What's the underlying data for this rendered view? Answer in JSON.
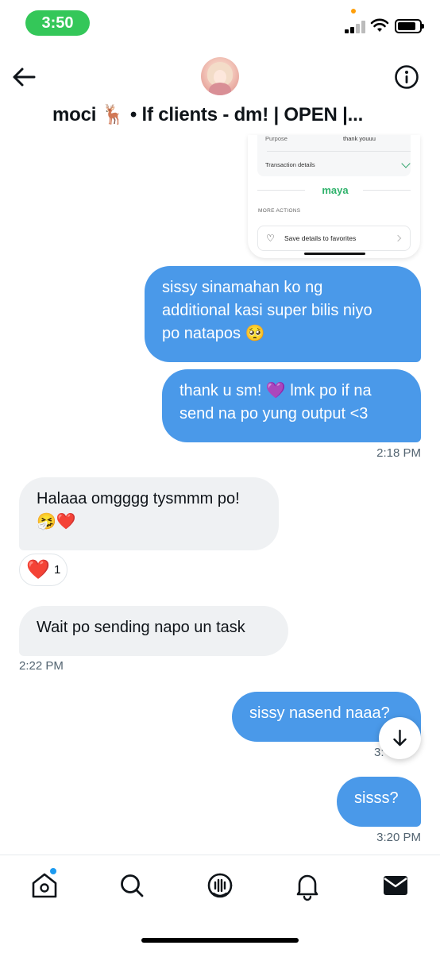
{
  "status_bar": {
    "time": "3:50"
  },
  "header": {
    "title": "moci 🦌 • lf clients - dm! | OPEN |..."
  },
  "screenshot": {
    "purpose_label": "Purpose",
    "purpose_value": "thank youuu",
    "transaction_details_label": "Transaction details",
    "brand": "maya",
    "more_actions_label": "MORE ACTIONS",
    "favorites_label": "Save details to favorites"
  },
  "messages": [
    {
      "id": "m1",
      "direction": "outgoing",
      "lines": [
        "sissy sinamahan ko ng",
        "additional kasi super bilis niyo",
        "po natapos 🥺"
      ]
    },
    {
      "id": "m2",
      "direction": "outgoing",
      "lines": [
        "thank u sm! 💜 lmk po if na",
        "send na po yung output <3"
      ],
      "timestamp": "2:18 PM"
    },
    {
      "id": "m3",
      "direction": "incoming",
      "lines": [
        "Halaaa omgggg tysmmm po!",
        "🤧❤️"
      ],
      "reaction": {
        "emoji": "❤️",
        "count": "1"
      }
    },
    {
      "id": "m4",
      "direction": "incoming",
      "lines": [
        "Wait po sending napo un task"
      ],
      "timestamp": "2:22 PM"
    },
    {
      "id": "m5",
      "direction": "outgoing",
      "lines": [
        "sissy nasend naaa?"
      ],
      "timestamp": "3:"
    },
    {
      "id": "m6",
      "direction": "outgoing",
      "lines": [
        "sisss?"
      ],
      "timestamp": "3:20 PM"
    }
  ],
  "nav": {
    "items": [
      {
        "name": "home",
        "icon": "home-icon",
        "has_notification_dot": true
      },
      {
        "name": "search",
        "icon": "search-icon"
      },
      {
        "name": "spaces",
        "icon": "spaces-icon"
      },
      {
        "name": "notifications",
        "icon": "bell-icon"
      },
      {
        "name": "messages",
        "icon": "envelope-icon",
        "active": true
      }
    ]
  },
  "colors": {
    "outgoing_bubble": "#4a99e9",
    "incoming_bubble": "#eff1f3",
    "timestamp": "#536471",
    "time_pill": "#34c759",
    "reaction_heart": "#e0245e",
    "notification_dot": "#1d9bf0",
    "maya_green": "#2fb26b"
  }
}
